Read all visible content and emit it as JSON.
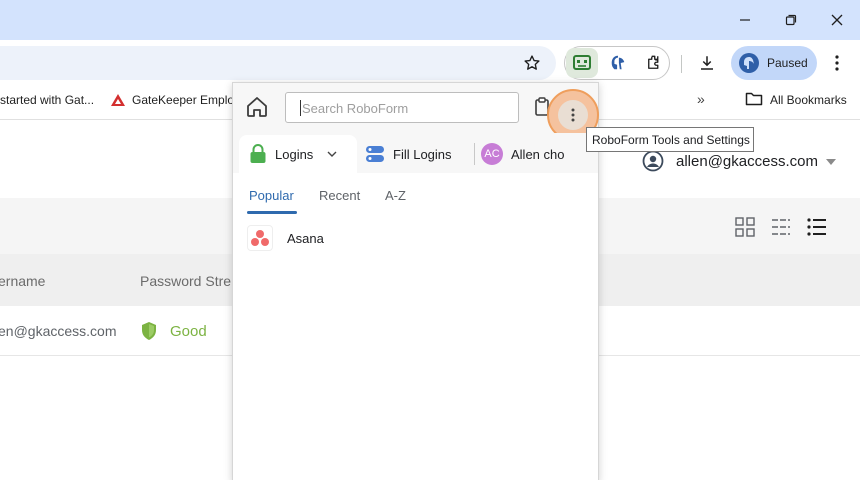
{
  "bookmarks_bar": {
    "item1_label": "started with Gat...",
    "item2_label": "GateKeeper Employ",
    "all_bookmarks_label": "All Bookmarks"
  },
  "profile": {
    "status_label": "Paused"
  },
  "page": {
    "user_email": "allen@gkaccess.com",
    "table": {
      "col_username": "ername",
      "col_password_strength": "Password Stre",
      "rows": [
        {
          "email": "en@gkaccess.com",
          "strength": "Good"
        }
      ]
    }
  },
  "roboform": {
    "search_placeholder": "Search RoboForm",
    "tabs": {
      "logins": "Logins",
      "fill_logins": "Fill Logins",
      "user_initials": "AC",
      "user_name": "Allen cho"
    },
    "subtabs": {
      "popular": "Popular",
      "recent": "Recent",
      "az": "A-Z"
    },
    "items": [
      {
        "name": "Asana"
      }
    ],
    "tooltip": "RoboForm Tools and Settings"
  },
  "colors": {
    "title_bar": "#d3e3fd",
    "roboform_accent": "#2f6aae",
    "good_green": "#7cb342",
    "highlight_orange": "#ef9a54"
  }
}
